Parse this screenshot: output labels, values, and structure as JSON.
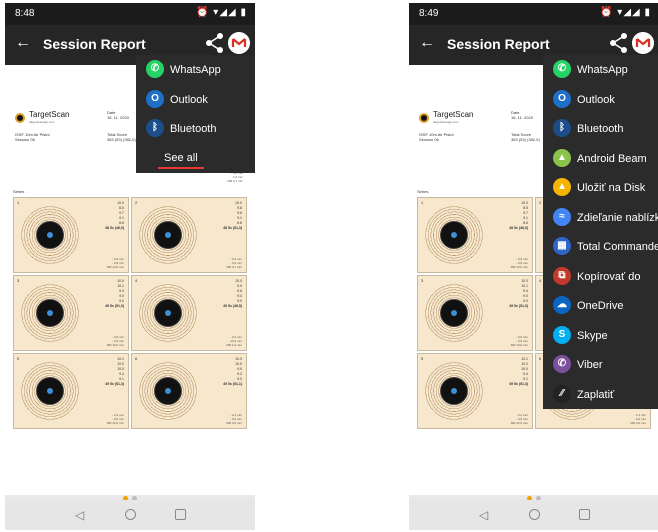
{
  "left_phone": {
    "time": "8:48",
    "status_icons": "⏰ ▾◢◢ ▮",
    "title": "Session Report",
    "menu": {
      "items": [
        {
          "label": "WhatsApp",
          "icon": "whatsapp-icon",
          "color": "#25d366",
          "glyph": "✆"
        },
        {
          "label": "Outlook",
          "icon": "outlook-icon",
          "color": "#1e6fc8",
          "glyph": "O"
        },
        {
          "label": "Bluetooth",
          "icon": "bluetooth-icon",
          "color": "#1c4f8a",
          "glyph": "ᛒ"
        }
      ],
      "see_all": "See all"
    }
  },
  "right_phone": {
    "time": "8:49",
    "status_icons": "⏰ ▾◢◢ ▮",
    "title": "Session Report",
    "menu": {
      "items": [
        {
          "label": "WhatsApp",
          "icon": "whatsapp-icon",
          "color": "#25d366",
          "glyph": "✆"
        },
        {
          "label": "Outlook",
          "icon": "outlook-icon",
          "color": "#1e6fc8",
          "glyph": "O"
        },
        {
          "label": "Bluetooth",
          "icon": "bluetooth-icon",
          "color": "#1c4f8a",
          "glyph": "ᛒ"
        },
        {
          "label": "Android Beam",
          "icon": "android-beam-icon",
          "color": "#8bc34a",
          "glyph": "▲"
        },
        {
          "label": "Uložiť na Disk",
          "icon": "google-drive-icon",
          "color": "#f4b400",
          "glyph": "▲"
        },
        {
          "label": "Zdieľanie nablízku",
          "icon": "nearby-share-icon",
          "color": "#4285f4",
          "glyph": "≈"
        },
        {
          "label": "Total Commander",
          "icon": "total-commander-icon",
          "color": "#2f64c8",
          "glyph": "▦"
        },
        {
          "label": "Kopírovať do",
          "icon": "copy-to-icon",
          "color": "#c0392b",
          "glyph": "⧉"
        },
        {
          "label": "OneDrive",
          "icon": "onedrive-icon",
          "color": "#0a66c2",
          "glyph": "☁"
        },
        {
          "label": "Skype",
          "icon": "skype-icon",
          "color": "#00aff0",
          "glyph": "S"
        },
        {
          "label": "Viber",
          "icon": "viber-icon",
          "color": "#7b519d",
          "glyph": "✆"
        },
        {
          "label": "Zaplatiť",
          "icon": "pay-icon",
          "color": "#222222",
          "glyph": "⁄⁄"
        }
      ]
    }
  },
  "report": {
    "brand": "TargetScan",
    "brand_sub": "targetscanapp.com",
    "event": "ISSF 10m Air Pistol",
    "session": "Session 06",
    "date_label": "Date",
    "date": "16. 11. 2020",
    "total_label": "Total Score",
    "total": "383 (53) (382,0)",
    "series_label": "Series",
    "series": [
      {
        "num": "1",
        "scores": "10.0\n8.5\n9.7\n9.1\n8.6",
        "total": "48 5x (46,0)",
        "dev": "- 0,9 mm\n- 0,8 mm\nMR 12,0 mm"
      },
      {
        "num": "2",
        "scores": "10.0\n9.8\n9.6\n9.1\n8.8",
        "total": "48 5x (51,3)",
        "dev": "- 0,9 mm\n- 0,2 mm\nMR 0,7 mm"
      },
      {
        "num": "3",
        "scores": "10.0\n10.1\n9.4\n9.0\n9.0",
        "total": "49 5x (51,0)",
        "dev": "- 0,0 mm\n- 0,9 mm\nMR 10,0 mm"
      },
      {
        "num": "4",
        "scores": "10.0\n9.9\n9.6\n9.4\n9.0",
        "total": "49 5x (46,5)",
        "dev": "- 0,2 mm\n- 10,0 mm\nMR 1,0 mm"
      },
      {
        "num": "5",
        "scores": "10.1\n10.0\n10.0\n9.4\n9.1",
        "total": "49 5x (51,3)",
        "dev": "- 0,2 mm\n- 0,9 mm\nMR 12,0 mm"
      },
      {
        "num": "6",
        "scores": "10.0\n10.0\n9.9\n9.2\n9.0",
        "total": "49 5x (51,1)",
        "dev": "- 0,1 mm\n- 0,0 mm\nMR 0,0 mm"
      }
    ],
    "partial_dev": "- 0,2 mm\n1,0 mm\nMR 0,7 mm"
  }
}
